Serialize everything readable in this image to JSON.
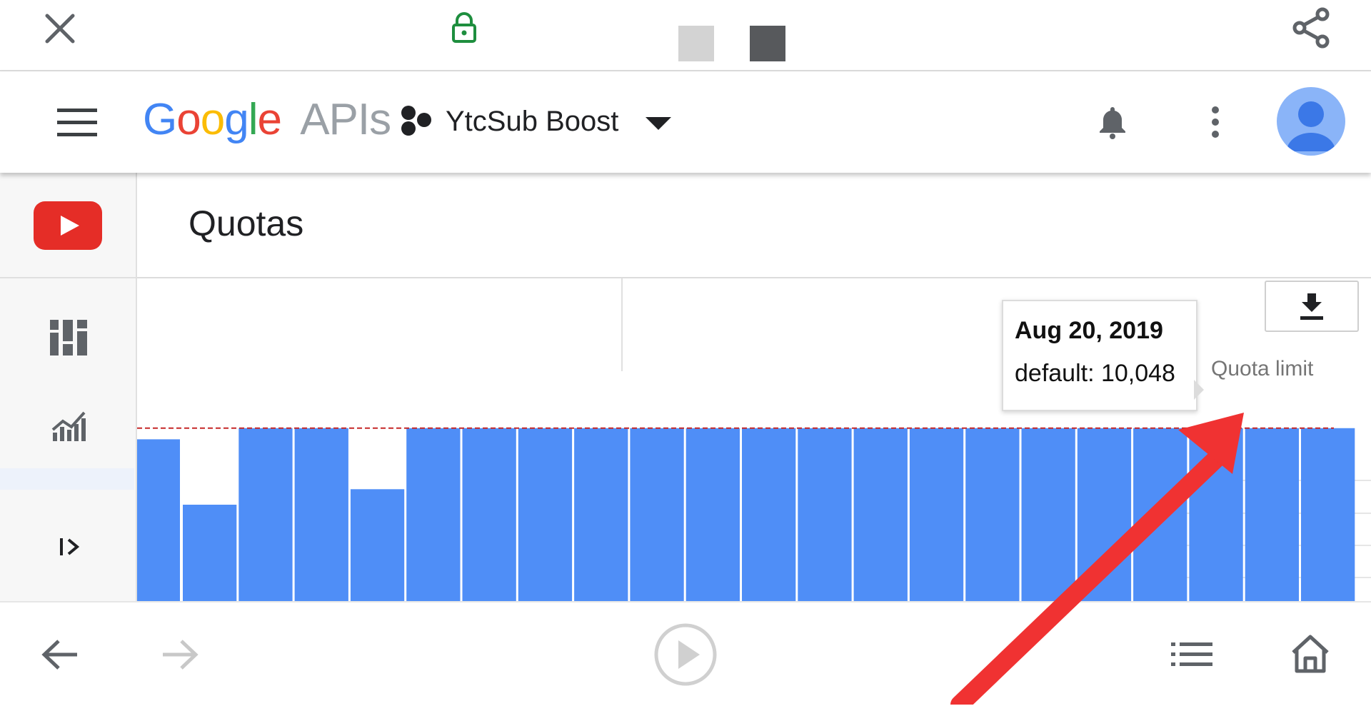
{
  "browser": {
    "icons": [
      "close-icon",
      "lock-icon",
      "tab-thumbnail",
      "tab-thumbnail-dark",
      "share-icon"
    ]
  },
  "header": {
    "brand_letters": [
      "G",
      "o",
      "o",
      "g",
      "l",
      "e"
    ],
    "brand_colors": [
      "#4285F4",
      "#EA4335",
      "#FBBC05",
      "#4285F4",
      "#34A853",
      "#EA4335"
    ],
    "brand_suffix": "APIs",
    "project_name": "YtcSub Boost",
    "icons": [
      "menu-icon",
      "project-hexagon-icon",
      "dropdown-caret-icon",
      "bell-icon",
      "more-vert-icon",
      "account-avatar"
    ]
  },
  "sidebar": {
    "items": [
      {
        "icon": "youtube-logo",
        "selected": false
      },
      {
        "icon": "dashboard-icon",
        "selected": false
      },
      {
        "icon": "metrics-chart-icon",
        "selected": false
      },
      {
        "icon": "quotas-icon",
        "selected": true
      },
      {
        "icon": "expand-sidebar-icon",
        "selected": false
      }
    ]
  },
  "page": {
    "title": "Quotas"
  },
  "chart_data": {
    "type": "bar",
    "quota_limit_label": "Quota limit",
    "reference_line": {
      "label": "Quota limit",
      "style": "dashed",
      "color": "#c62828"
    },
    "bar_color": "#4f8ef7",
    "series": [
      {
        "name": "default",
        "values": [
          9400,
          5600,
          10048,
          10048,
          6500,
          10048,
          10048,
          10048,
          10048,
          10048,
          10048,
          10048,
          10048,
          10048,
          10048,
          10048,
          10048,
          10048,
          10048,
          10048,
          10048,
          10048
        ]
      }
    ],
    "limit": 10048,
    "y_max": 18000,
    "tooltip": {
      "date": "Aug 20, 2019",
      "series_label": "default: 10,048"
    },
    "highlighted_index": 20
  },
  "annotation": {
    "arrow_color": "#f03232"
  },
  "bottom_nav": {
    "icons": [
      "back-icon",
      "forward-icon",
      "play-icon",
      "list-icon",
      "home-icon"
    ]
  }
}
